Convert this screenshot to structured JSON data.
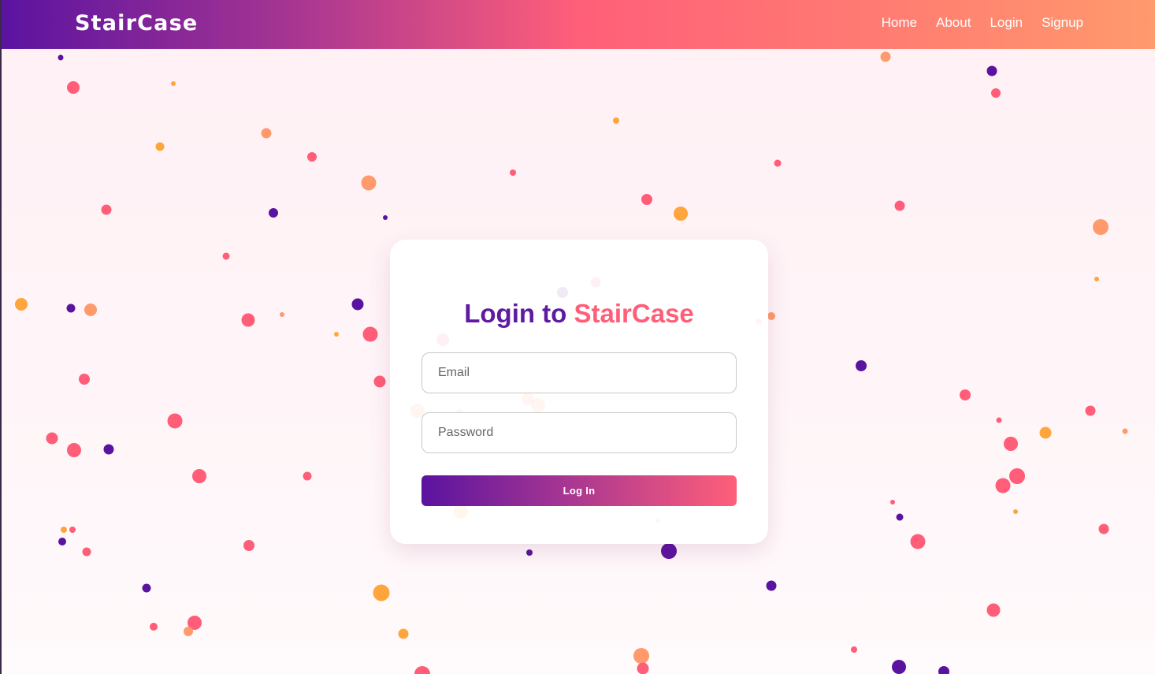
{
  "navbar": {
    "brand": "StairCase",
    "links": [
      {
        "label": "Home"
      },
      {
        "label": "About"
      },
      {
        "label": "Login"
      },
      {
        "label": "Signup"
      }
    ]
  },
  "login_card": {
    "title_prefix": "Login to",
    "title_brand": "StairCase",
    "email_placeholder": "Email",
    "password_placeholder": "Password",
    "submit_label": "Log In"
  },
  "colors": {
    "purple": "#5a13a0",
    "pink": "#ff5d78",
    "salmon": "#ff9a6c",
    "orange": "#ffa53d"
  }
}
